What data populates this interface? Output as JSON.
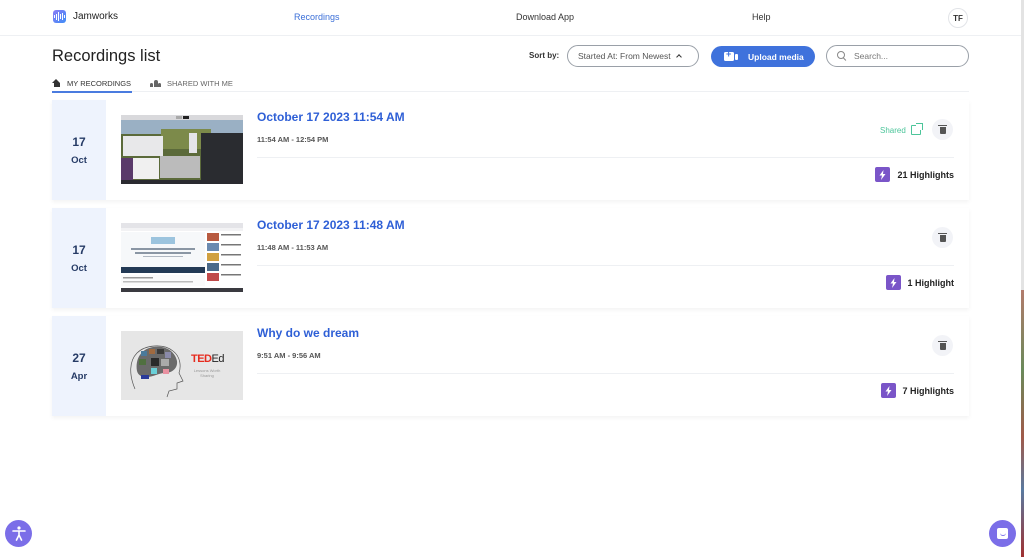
{
  "app": {
    "name": "Jamworks",
    "brand_color": "#3f72dc",
    "accent_purple": "#7a55c8"
  },
  "nav": {
    "links": [
      {
        "label": "Recordings",
        "active": true
      },
      {
        "label": "Download App",
        "active": false
      },
      {
        "label": "Help",
        "active": false
      }
    ],
    "avatar_initials": "TF"
  },
  "header": {
    "title": "Recordings list",
    "sort_label": "Sort by:",
    "sort_value": "Started At: From Newest",
    "upload_label": "Upload media",
    "search_placeholder": "Search..."
  },
  "tabs": [
    {
      "label": "MY RECORDINGS",
      "icon": "home-icon",
      "active": true
    },
    {
      "label": "SHARED WITH ME",
      "icon": "users-icon",
      "active": false
    }
  ],
  "recordings": [
    {
      "day": "17",
      "month": "Oct",
      "title": "October 17 2023 11:54 AM",
      "time_range": "11:54 AM - 12:54 PM",
      "shared": true,
      "shared_label": "Shared",
      "highlights": "21 Highlights",
      "thumbnail": "desktop-screenshot"
    },
    {
      "day": "17",
      "month": "Oct",
      "title": "October 17 2023 11:48 AM",
      "time_range": "11:48 AM - 11:53 AM",
      "shared": false,
      "highlights": "1 Highlight",
      "thumbnail": "youtube-video-page",
      "thumbnail_text": "An Auto Encoder For Audio Dolphin Communication"
    },
    {
      "day": "27",
      "month": "Apr",
      "title": "Why do we dream",
      "time_range": "9:51 AM - 9:56 AM",
      "shared": false,
      "highlights": "7 Highlights",
      "thumbnail": "ted-ed-brain",
      "thumbnail_brand": "TED",
      "thumbnail_brand_suffix": "Ed",
      "thumbnail_tagline": "Lessons Worth Sharing"
    }
  ]
}
